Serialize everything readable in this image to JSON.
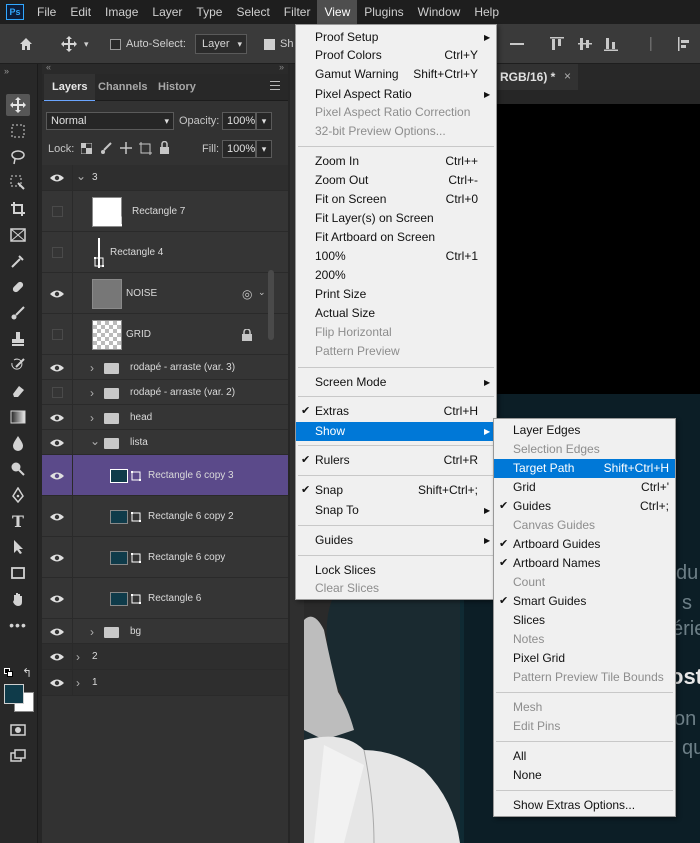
{
  "menubar": {
    "logo": "Ps",
    "items": [
      "File",
      "Edit",
      "Image",
      "Layer",
      "Type",
      "Select",
      "Filter",
      "View",
      "Plugins",
      "Window",
      "Help"
    ],
    "active": "View"
  },
  "options": {
    "auto_select_label": "Auto-Select:",
    "auto_select_value": "Layer",
    "show_transform_label": "Sh"
  },
  "doc_tab": {
    "title": "RGB/16) *",
    "close": "×"
  },
  "panel": {
    "tabs": [
      "Layers",
      "Channels",
      "History"
    ],
    "blend_mode": "Normal",
    "opacity_label": "Opacity:",
    "opacity": "100%",
    "lock_label": "Lock:",
    "fill_label": "Fill:",
    "fill": "100%"
  },
  "layers": [
    {
      "name": "3",
      "type": "group",
      "visible": true,
      "expanded": true
    },
    {
      "name": "Rectangle 7",
      "type": "shape",
      "visible": false
    },
    {
      "name": "Rectangle 4",
      "type": "shape",
      "visible": false
    },
    {
      "name": "NOISE",
      "type": "smart",
      "visible": true
    },
    {
      "name": "GRID",
      "type": "pixel",
      "visible": false,
      "locked": true
    },
    {
      "name": "rodapé - arraste (var. 3)",
      "type": "folder",
      "visible": true
    },
    {
      "name": "rodapé - arraste (var. 2)",
      "type": "folder",
      "visible": false
    },
    {
      "name": "head",
      "type": "folder",
      "visible": true
    },
    {
      "name": "lista",
      "type": "folder",
      "visible": true,
      "expanded": true
    },
    {
      "name": "Rectangle 6 copy 3",
      "type": "shape",
      "visible": true,
      "selected": true
    },
    {
      "name": "Rectangle 6 copy 2",
      "type": "shape",
      "visible": true
    },
    {
      "name": "Rectangle 6 copy",
      "type": "shape",
      "visible": true
    },
    {
      "name": "Rectangle 6",
      "type": "shape",
      "visible": true
    },
    {
      "name": "bg",
      "type": "folder",
      "visible": true
    },
    {
      "name": "2",
      "type": "group",
      "visible": true
    },
    {
      "name": "1",
      "type": "group",
      "visible": true
    }
  ],
  "view_menu": [
    {
      "label": "Proof Setup",
      "submenu": true
    },
    {
      "label": "Proof Colors",
      "shortcut": "Ctrl+Y"
    },
    {
      "label": "Gamut Warning",
      "shortcut": "Shift+Ctrl+Y"
    },
    {
      "label": "Pixel Aspect Ratio",
      "submenu": true
    },
    {
      "label": "Pixel Aspect Ratio Correction",
      "disabled": true
    },
    {
      "label": "32-bit Preview Options...",
      "disabled": true
    },
    {
      "label": "Zoom In",
      "shortcut": "Ctrl++"
    },
    {
      "label": "Zoom Out",
      "shortcut": "Ctrl+-"
    },
    {
      "label": "Fit on Screen",
      "shortcut": "Ctrl+0"
    },
    {
      "label": "Fit Layer(s) on Screen"
    },
    {
      "label": "Fit Artboard on Screen"
    },
    {
      "label": "100%",
      "shortcut": "Ctrl+1"
    },
    {
      "label": "200%"
    },
    {
      "label": "Print Size"
    },
    {
      "label": "Actual Size"
    },
    {
      "label": "Flip Horizontal",
      "disabled": true
    },
    {
      "label": "Pattern Preview",
      "disabled": true
    },
    {
      "label": "Screen Mode",
      "submenu": true
    },
    {
      "label": "Extras",
      "shortcut": "Ctrl+H",
      "checked": true
    },
    {
      "label": "Show",
      "submenu": true,
      "highlighted": true
    },
    {
      "label": "Rulers",
      "shortcut": "Ctrl+R",
      "checked": true
    },
    {
      "label": "Snap",
      "shortcut": "Shift+Ctrl+;",
      "checked": true
    },
    {
      "label": "Snap To",
      "submenu": true
    },
    {
      "label": "Guides",
      "submenu": true
    },
    {
      "label": "Lock Slices"
    },
    {
      "label": "Clear Slices",
      "disabled": true
    }
  ],
  "show_menu": [
    {
      "label": "Layer Edges"
    },
    {
      "label": "Selection Edges",
      "disabled": true
    },
    {
      "label": "Target Path",
      "shortcut": "Shift+Ctrl+H",
      "highlighted": true
    },
    {
      "label": "Grid",
      "shortcut": "Ctrl+'"
    },
    {
      "label": "Guides",
      "shortcut": "Ctrl+;",
      "checked": true
    },
    {
      "label": "Canvas Guides",
      "disabled": true
    },
    {
      "label": "Artboard Guides",
      "checked": true
    },
    {
      "label": "Artboard Names",
      "checked": true
    },
    {
      "label": "Count",
      "disabled": true
    },
    {
      "label": "Smart Guides",
      "checked": true
    },
    {
      "label": "Slices"
    },
    {
      "label": "Notes",
      "disabled": true
    },
    {
      "label": "Pixel Grid"
    },
    {
      "label": "Pattern Preview Tile Bounds",
      "disabled": true
    },
    {
      "label": "Mesh",
      "disabled": true
    },
    {
      "label": "Edit Pins",
      "disabled": true
    },
    {
      "label": "All"
    },
    {
      "label": "None"
    },
    {
      "label": "Show Extras Options..."
    }
  ],
  "canvas_text": [
    "du",
    "s",
    "érie",
    "osti",
    "on",
    "qu"
  ],
  "colors": {
    "accent": "#0078d7",
    "selected_layer": "#5b4a8a",
    "panel": "#323232"
  }
}
